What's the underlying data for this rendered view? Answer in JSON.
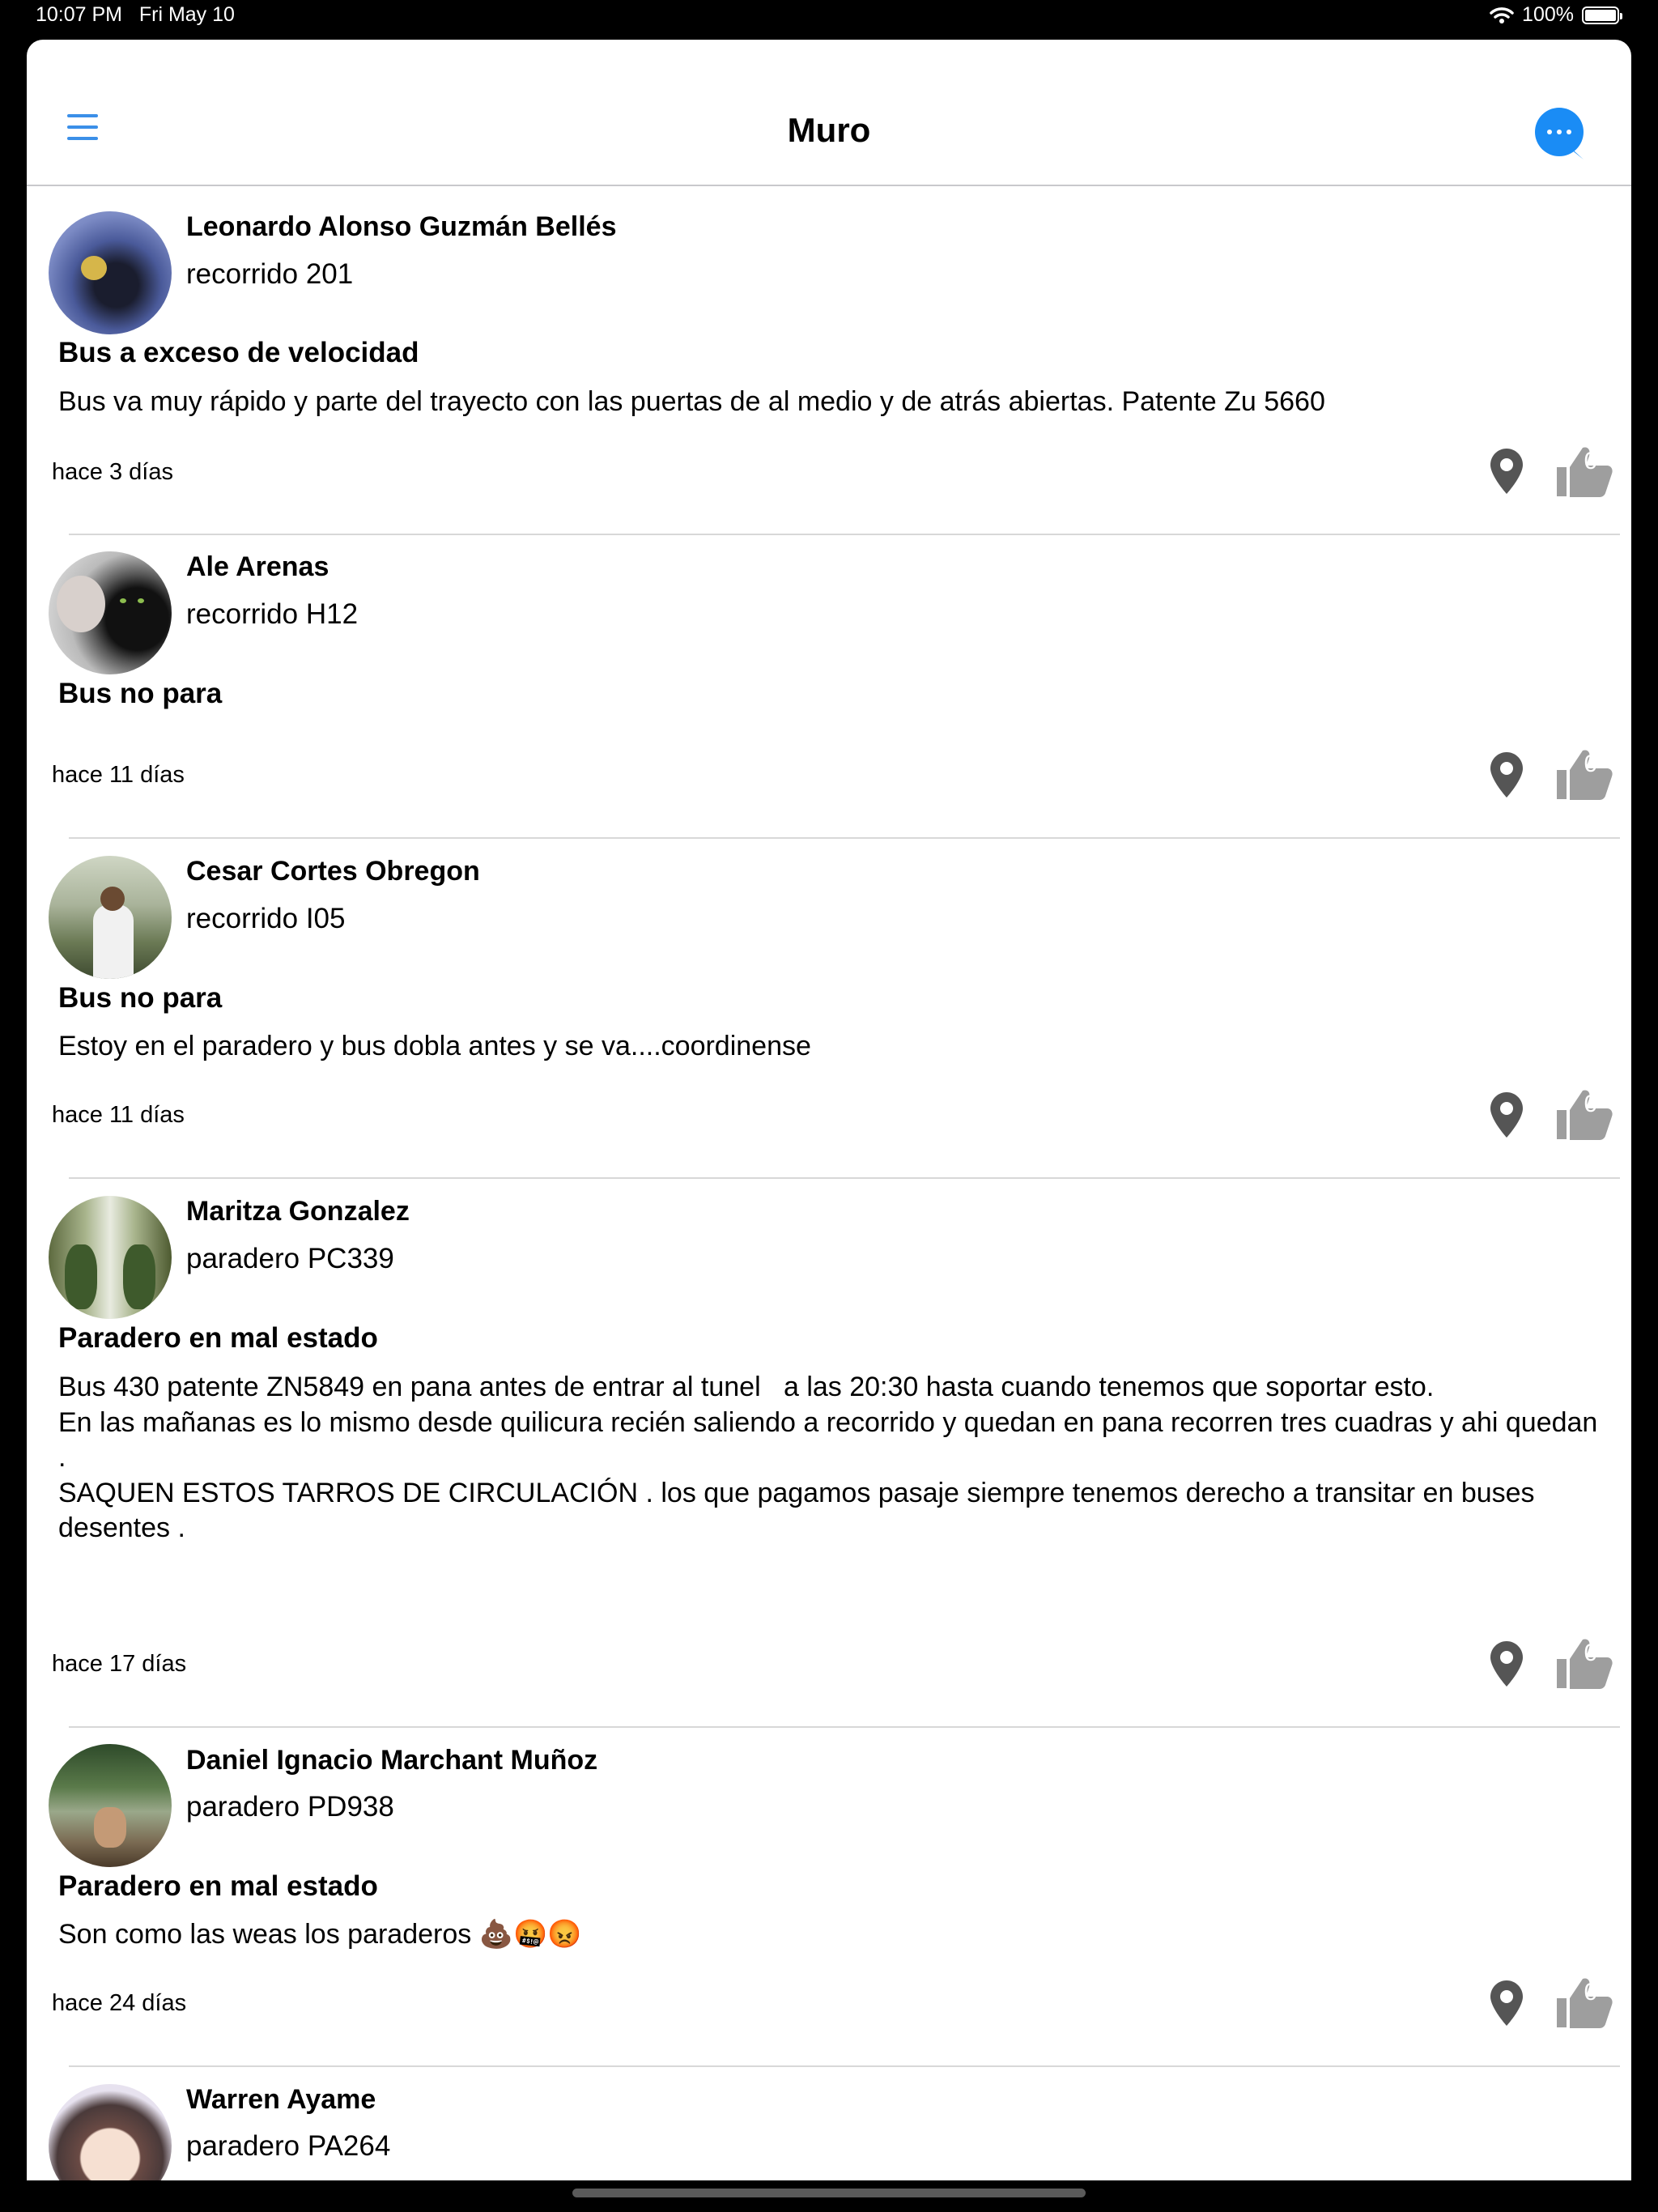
{
  "status_bar": {
    "time": "10:07 PM",
    "date": "Fri May 10",
    "battery": "100%"
  },
  "nav": {
    "title": "Muro",
    "menu_icon": "hamburger-menu-icon",
    "chat_icon": "chat-bubble-icon",
    "accent": "#1a8cf5"
  },
  "posts": [
    {
      "author": "Leonardo Alonso Guzmán Bellés",
      "route": "recorrido 201",
      "title": "Bus a exceso de velocidad",
      "body": "Bus va muy rápido y parte del trayecto con las puertas de al medio y de atrás abiertas. Patente Zu 5660",
      "time": "hace 3 días",
      "likes": "0"
    },
    {
      "author": "Ale Arenas",
      "route": "recorrido H12",
      "title": "Bus no para",
      "body": "",
      "time": "hace 11 días",
      "likes": "0"
    },
    {
      "author": "Cesar Cortes Obregon",
      "route": "recorrido I05",
      "title": "Bus no para",
      "body": "Estoy en el paradero y bus dobla antes y se va....coordinense",
      "time": "hace 11 días",
      "likes": "0"
    },
    {
      "author": "Maritza Gonzalez",
      "route": "paradero PC339",
      "title": "Paradero en mal estado",
      "body": "Bus 430 patente ZN5849 en pana antes de entrar al tunel   a las 20:30 hasta cuando tenemos que soportar esto.\nEn las mañanas es lo mismo desde quilicura recién saliendo a recorrido y quedan en pana recorren tres cuadras y ahi quedan .\nSAQUEN ESTOS TARROS DE CIRCULACIÓN . los que pagamos pasaje siempre tenemos derecho a transitar en buses desentes .",
      "time": "hace 17 días",
      "likes": "0"
    },
    {
      "author": "Daniel Ignacio Marchant Muñoz",
      "route": "paradero PD938",
      "title": "Paradero en mal estado",
      "body": "Son como las weas los paraderos 💩🤬😡",
      "time": "hace 24 días",
      "likes": "0"
    },
    {
      "author": "Warren Ayame",
      "route": "paradero PA264"
    }
  ]
}
